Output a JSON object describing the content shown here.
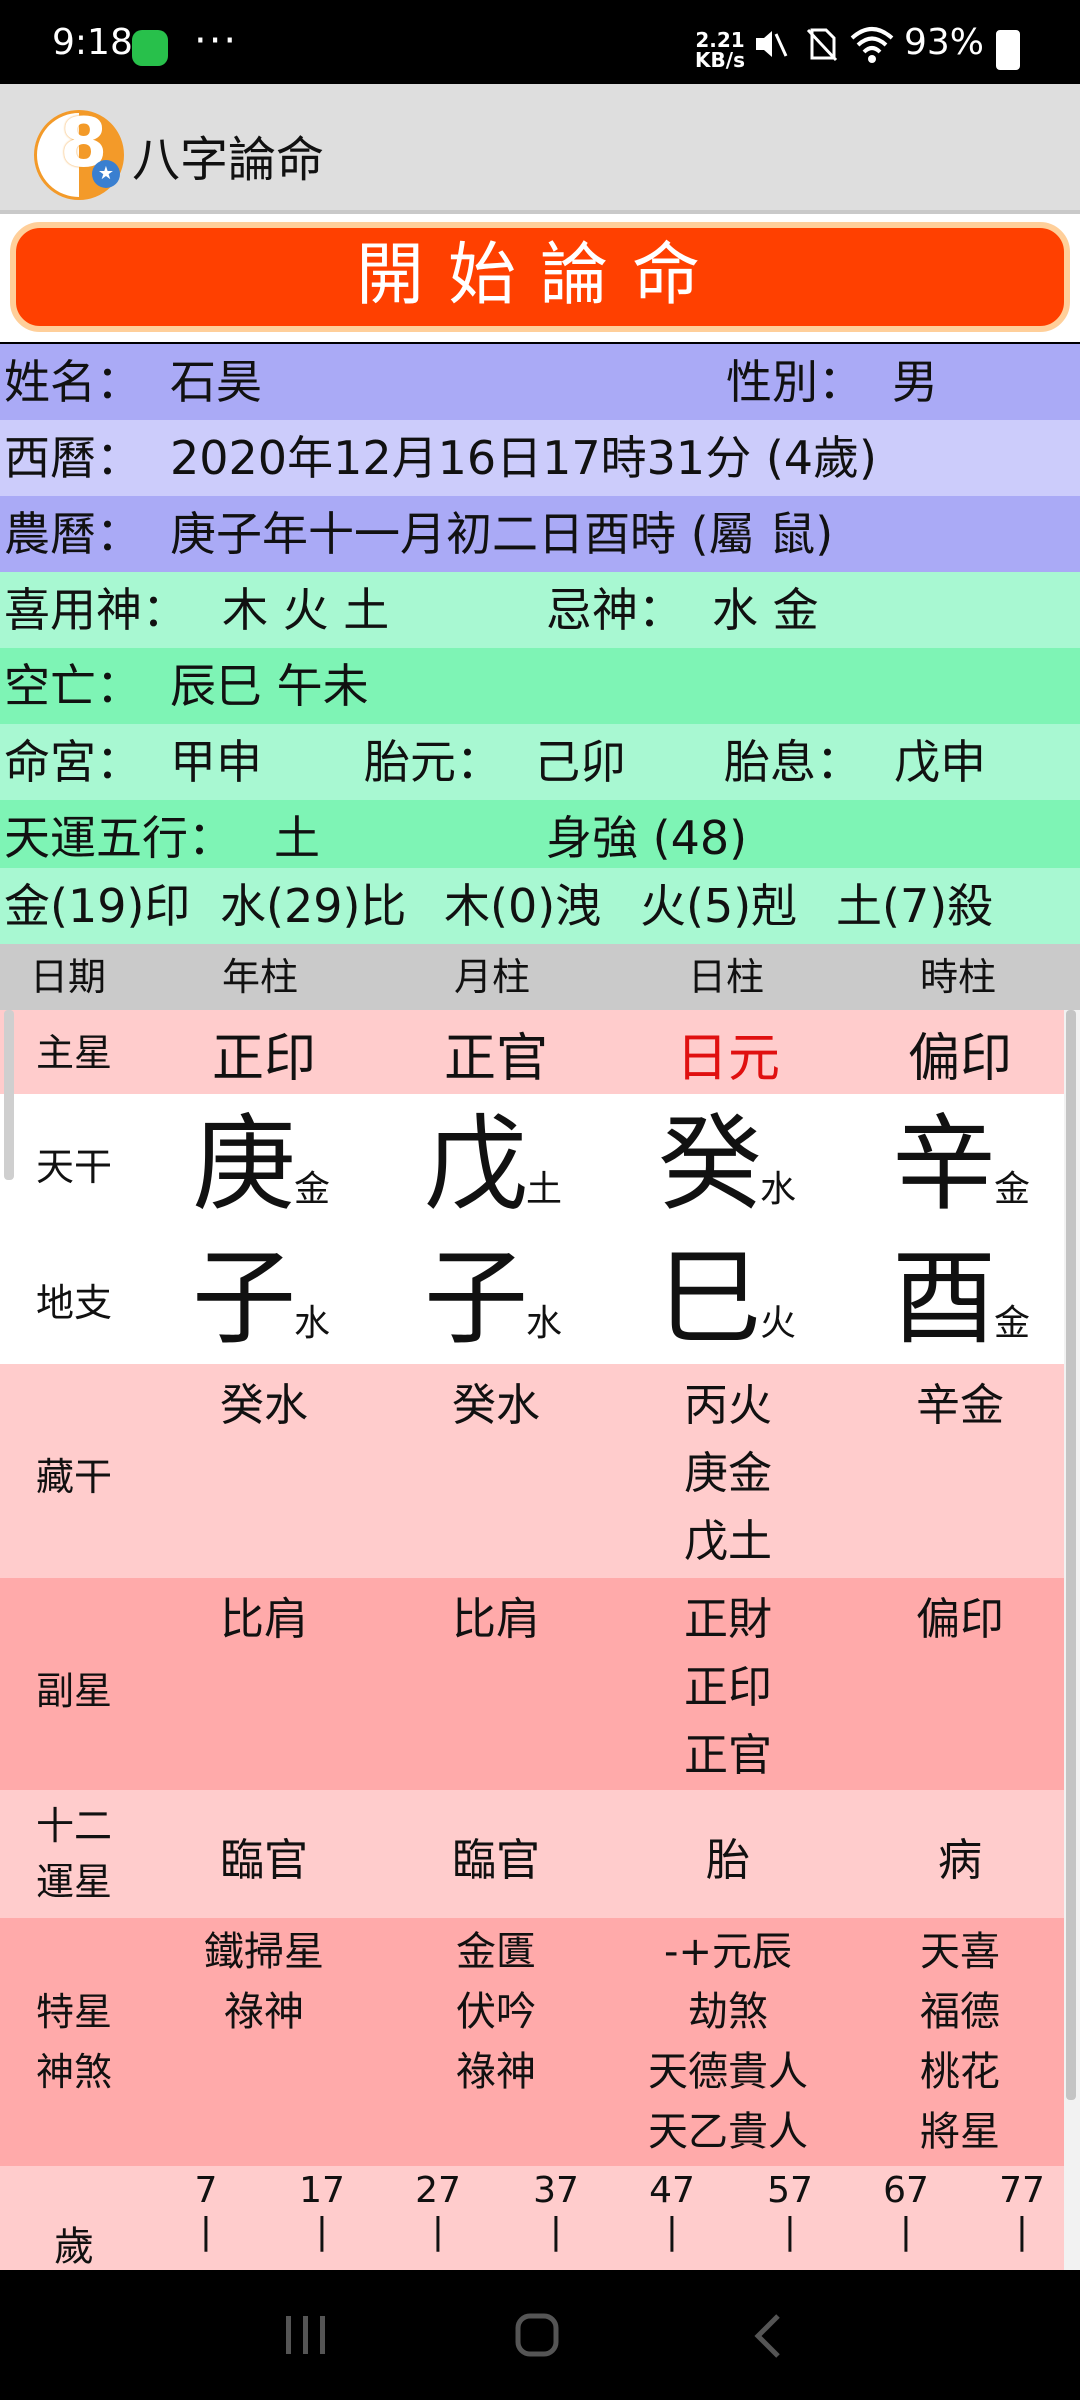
{
  "status": {
    "time": "9:18",
    "dots": "···",
    "speed_top": "2.21",
    "speed_bottom": "KB/s",
    "battery": "93%"
  },
  "app": {
    "title": "八字論命"
  },
  "banner": {
    "text": "開始論命"
  },
  "info": {
    "name_label": "姓名：",
    "name": "石昊",
    "gender_label": "性別：",
    "gender": "男",
    "solar_label": "西曆：",
    "solar": "2020年12月16日17時31分 (4歲)",
    "lunar_label": "農曆：",
    "lunar": "庚子年十一月初二日酉時 (屬 鼠)",
    "favorable_label": "喜用神：",
    "favorable": "木 火 土",
    "taboo_label": "忌神：",
    "taboo": "水 金",
    "void_label": "空亡：",
    "void": "辰巳 午未",
    "life_palace_label": "命宮：",
    "life_palace": "甲申",
    "fetal_origin_label": "胎元：",
    "fetal_origin": "己卯",
    "fetal_breath_label": "胎息：",
    "fetal_breath": "戊申",
    "luck_element_label": "天運五行：",
    "luck_element": "土",
    "strength": "身強 (48)",
    "elements": [
      "金(19)印",
      "水(29)比",
      "木(0)洩",
      "火(5)剋",
      "土(7)殺"
    ]
  },
  "columns": [
    "日期",
    "年柱",
    "月柱",
    "日柱",
    "時柱"
  ],
  "main_star": {
    "label": "主星",
    "values": [
      "正印",
      "正官",
      "日元",
      "偏印"
    ]
  },
  "heavenly": {
    "label": "天干",
    "stems": [
      "庚",
      "戊",
      "癸",
      "辛"
    ],
    "elems": [
      "金",
      "土",
      "水",
      "金"
    ]
  },
  "earthly": {
    "label": "地支",
    "branches": [
      "子",
      "子",
      "巳",
      "酉"
    ],
    "elems": [
      "水",
      "水",
      "火",
      "金"
    ]
  },
  "hidden": {
    "label": "藏干",
    "cols": [
      [
        "癸水"
      ],
      [
        "癸水"
      ],
      [
        "丙火",
        "庚金",
        "戊土"
      ],
      [
        "辛金"
      ]
    ]
  },
  "sub_star": {
    "label": "副星",
    "cols": [
      [
        "比肩"
      ],
      [
        "比肩"
      ],
      [
        "正財",
        "正印",
        "正官"
      ],
      [
        "偏印"
      ]
    ]
  },
  "twelve": {
    "label_top": "十二",
    "label_bottom": "運星",
    "values": [
      "臨官",
      "臨官",
      "胎",
      "病"
    ]
  },
  "special": {
    "label_top": "特星",
    "label_bottom": "神煞",
    "cols": [
      [
        "鐵掃星",
        "祿神"
      ],
      [
        "金匱",
        "伏吟",
        "祿神"
      ],
      [
        "-+元辰",
        "劫煞",
        "天德貴人",
        "天乙貴人"
      ],
      [
        "天喜",
        "福德",
        "桃花",
        "將星"
      ]
    ]
  },
  "age": {
    "label": "歲",
    "ticks": [
      "7",
      "17",
      "27",
      "37",
      "47",
      "57",
      "67",
      "77"
    ]
  },
  "colors": {
    "red_text": "#e01010",
    "banner": "#ff4000"
  }
}
